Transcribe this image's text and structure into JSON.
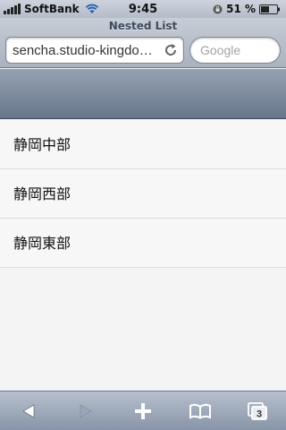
{
  "status_bar": {
    "carrier": "SoftBank",
    "time": "9:45",
    "battery_percent": "51 %"
  },
  "browser": {
    "title": "Nested List",
    "url": "sencha.studio-kingdo…",
    "search_placeholder": "Google",
    "tabs_count": "3"
  },
  "list": {
    "items": [
      {
        "label": "静岡中部"
      },
      {
        "label": "静岡西部"
      },
      {
        "label": "静岡東部"
      }
    ]
  },
  "icons": {
    "signal": "signal-bars-icon",
    "wifi": "wifi-icon",
    "lock": "rotation-lock-icon",
    "battery": "battery-icon",
    "reload": "reload-icon",
    "back": "back-arrow-icon",
    "forward": "forward-arrow-icon",
    "add": "plus-icon",
    "bookmarks": "bookmarks-icon",
    "tabs": "tabs-icon"
  }
}
